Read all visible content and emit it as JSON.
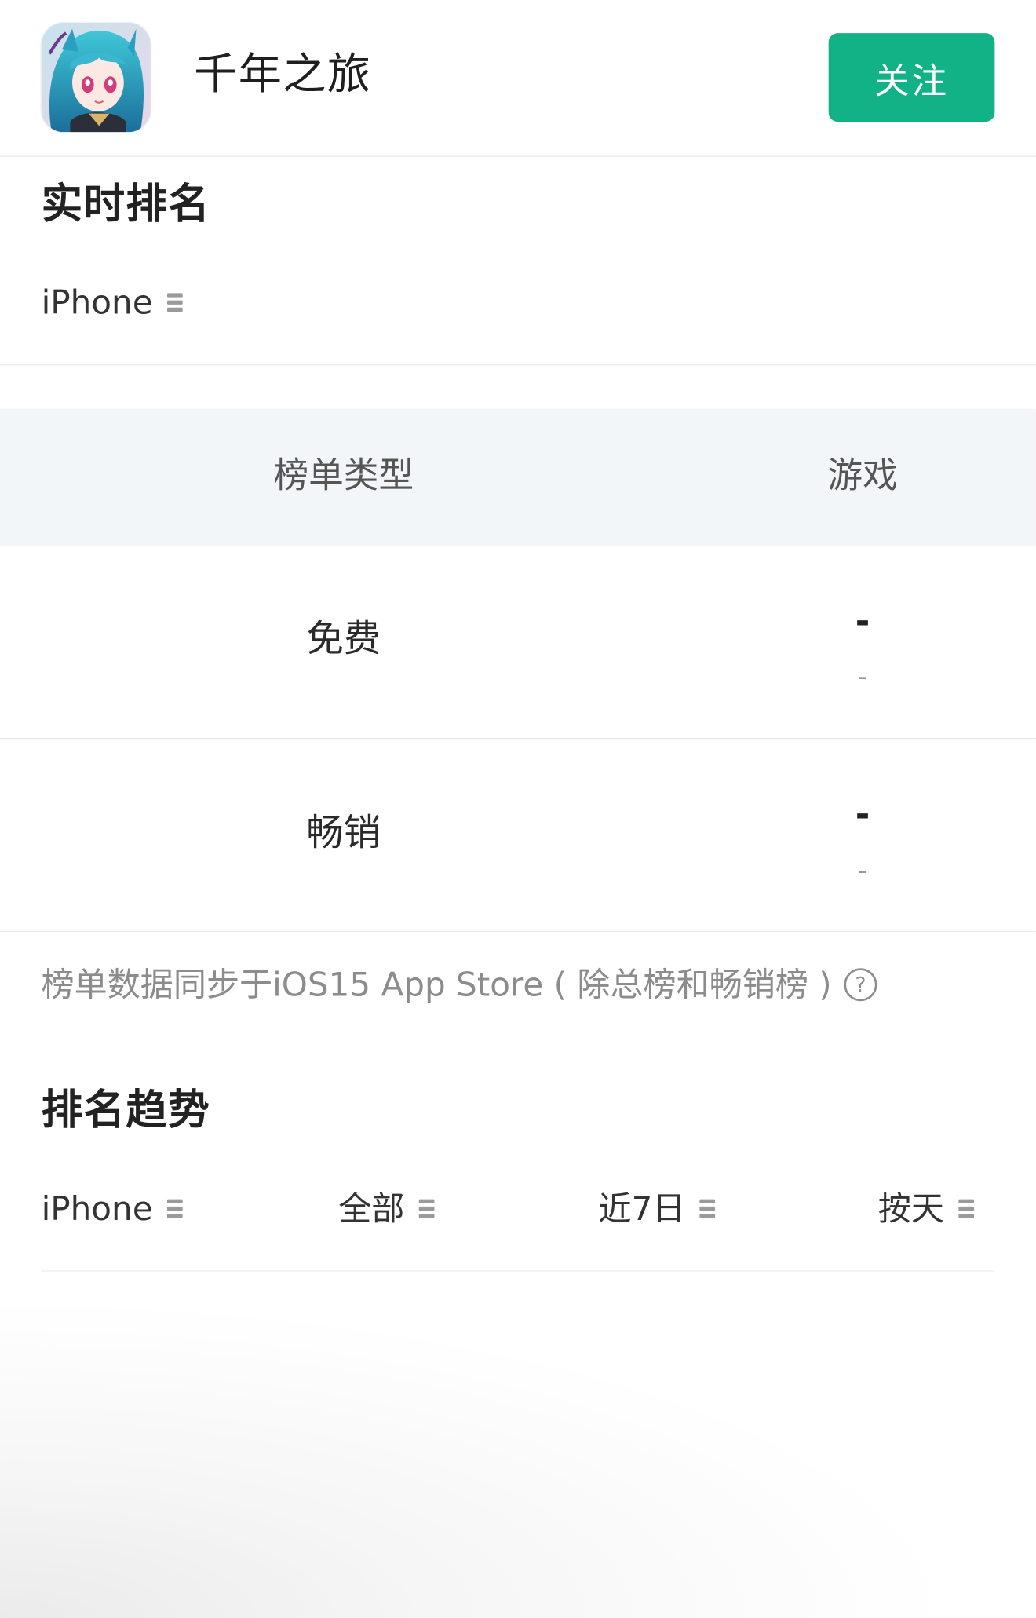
{
  "header": {
    "app_name": "千年之旅",
    "follow_label": "关注",
    "app_icon": "anime-character-app-icon"
  },
  "realtime": {
    "title": "实时排名",
    "device": "iPhone"
  },
  "table": {
    "col_type": "榜单类型",
    "col_category": "游戏",
    "rows": [
      {
        "label": "免费",
        "rank": "-",
        "change": "-"
      },
      {
        "label": "畅销",
        "rank": "-",
        "change": "-"
      }
    ]
  },
  "note": {
    "text": "榜单数据同步于iOS15 App Store ( 除总榜和畅销榜 )",
    "help_symbol": "?"
  },
  "trend": {
    "title": "排名趋势",
    "filters": {
      "device": "iPhone",
      "scope": "全部",
      "range": "近7日",
      "granularity": "按天"
    }
  },
  "colors": {
    "accent": "#11b386",
    "table_header_bg": "#f3f6f9",
    "divider": "#e9ebee"
  }
}
